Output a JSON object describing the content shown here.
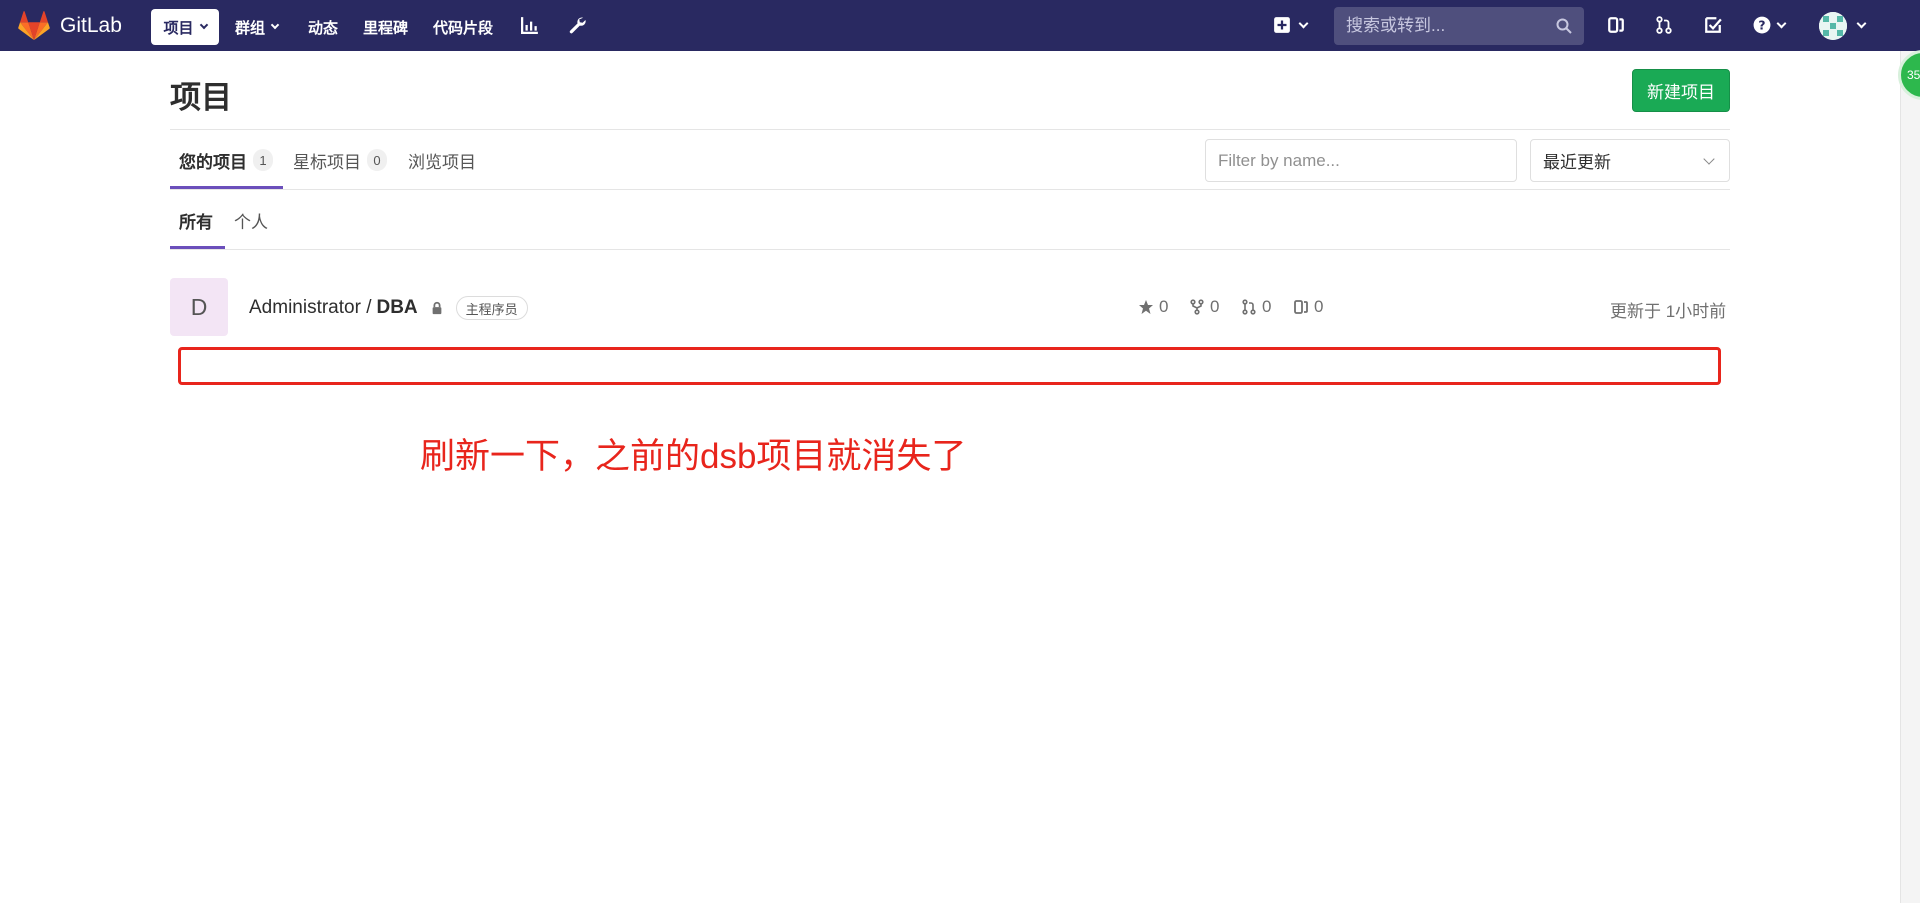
{
  "navbar": {
    "brand": "GitLab",
    "items": [
      {
        "label": "项目",
        "active": true,
        "has_caret": true
      },
      {
        "label": "群组",
        "active": false,
        "has_caret": true
      },
      {
        "label": "动态",
        "active": false,
        "has_caret": false
      },
      {
        "label": "里程碑",
        "active": false,
        "has_caret": false
      },
      {
        "label": "代码片段",
        "active": false,
        "has_caret": false
      }
    ],
    "icons": [
      "chart-icon",
      "wrench-icon",
      "plus-square-icon",
      "issues-icon",
      "merge-request-icon",
      "todo-icon",
      "help-icon",
      "user-avatar"
    ],
    "search_placeholder": "搜索或转到..."
  },
  "side_badge": "35",
  "page": {
    "title": "项目",
    "new_project_button": "新建项目",
    "tabs": [
      {
        "label": "您的项目",
        "count": "1",
        "active": true
      },
      {
        "label": "星标项目",
        "count": "0",
        "active": false
      },
      {
        "label": "浏览项目",
        "count": "",
        "active": false
      }
    ],
    "filter_placeholder": "Filter by name...",
    "sort_selected": "最近更新",
    "subtabs": [
      {
        "label": "所有",
        "active": true
      },
      {
        "label": "个人",
        "active": false
      }
    ]
  },
  "projects": [
    {
      "avatar_letter": "D",
      "namespace": "Administrator /",
      "name": "DBA",
      "visibility": "lock-icon",
      "role": "主程序员",
      "stars": "0",
      "forks": "0",
      "merge_requests": "0",
      "issues": "0",
      "updated": "更新于 1小时前"
    }
  ],
  "annotation": {
    "text": "刷新一下，之前的dsb项目就消失了",
    "color": "#e8251c"
  },
  "colors": {
    "navbar": "#292961",
    "primary_button": "#1aaa55",
    "tab_underline": "#6b4fbb"
  }
}
